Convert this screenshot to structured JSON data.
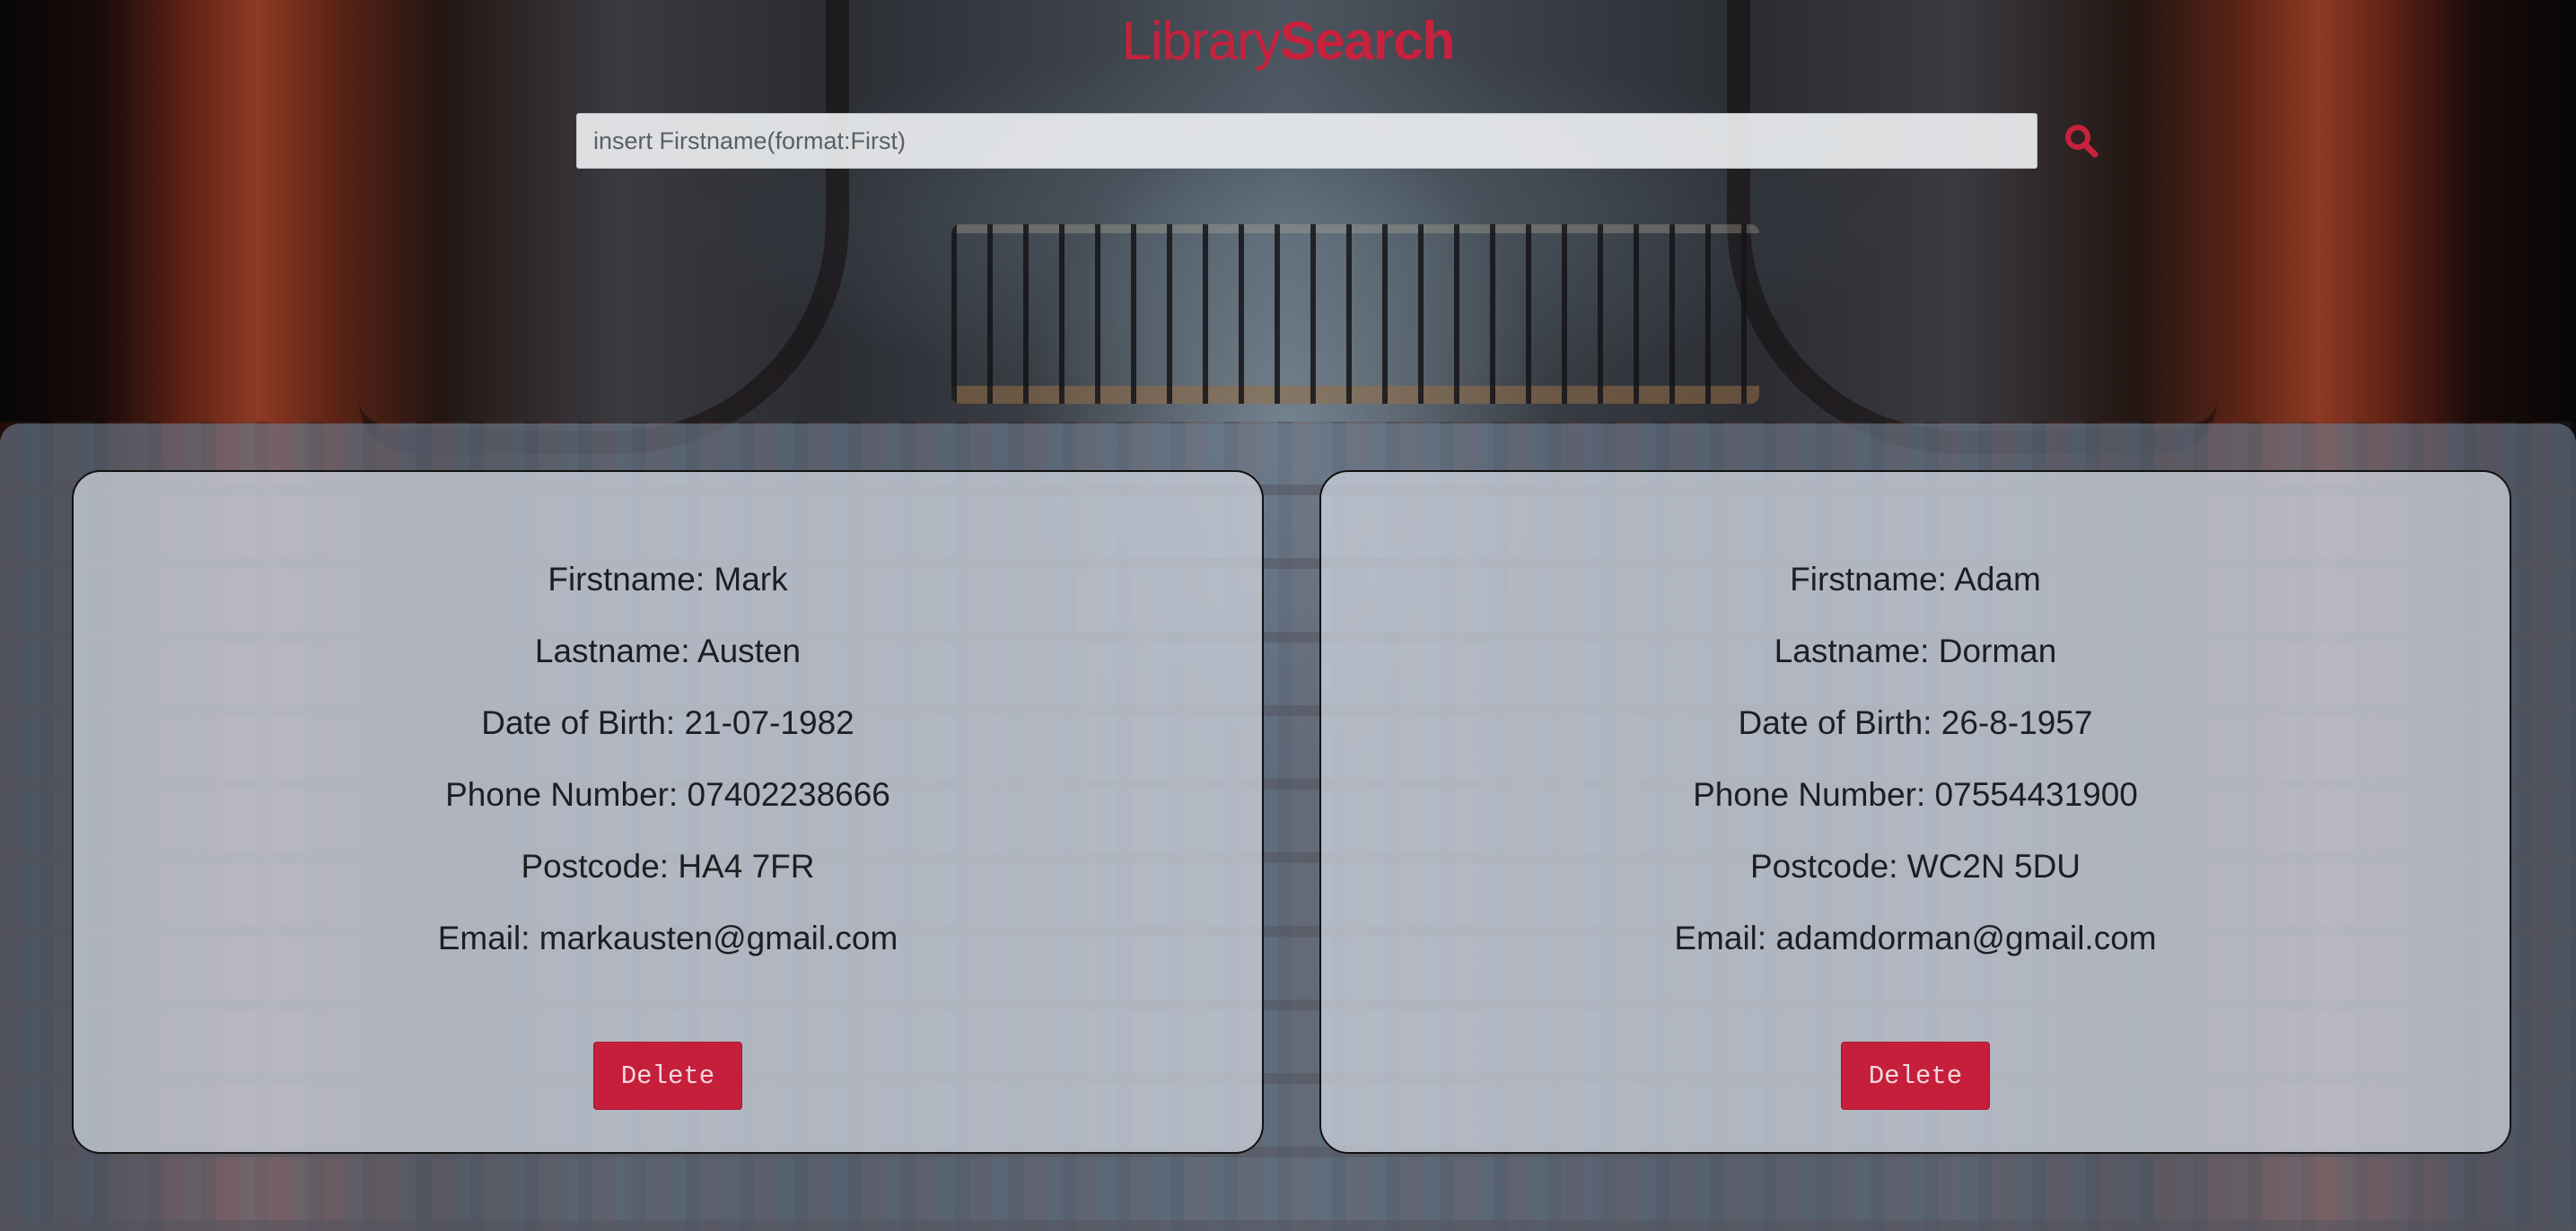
{
  "header": {
    "title_part1": "Library",
    "title_part2": "Search",
    "accent_color": "#c8213d"
  },
  "search": {
    "placeholder": "insert Firstname(format:First)",
    "value": "",
    "button_icon": "search-icon"
  },
  "results": [
    {
      "firstname": "Firstname: Mark",
      "lastname": "Lastname: Austen",
      "dob": "Date of Birth: 21-07-1982",
      "phone": "Phone Number: 07402238666",
      "postcode": "Postcode: HA4 7FR",
      "email": "Email: markausten@gmail.com",
      "delete_label": "Delete"
    },
    {
      "firstname": "Firstname: Adam",
      "lastname": "Lastname: Dorman",
      "dob": "Date of Birth: 26-8-1957",
      "phone": "Phone Number: 07554431900",
      "postcode": "Postcode: WC2N 5DU",
      "email": "Email: adamdorman@gmail.com",
      "delete_label": "Delete"
    }
  ],
  "colors": {
    "delete_button": "#c51f3b",
    "panel": "#6e7e92"
  }
}
